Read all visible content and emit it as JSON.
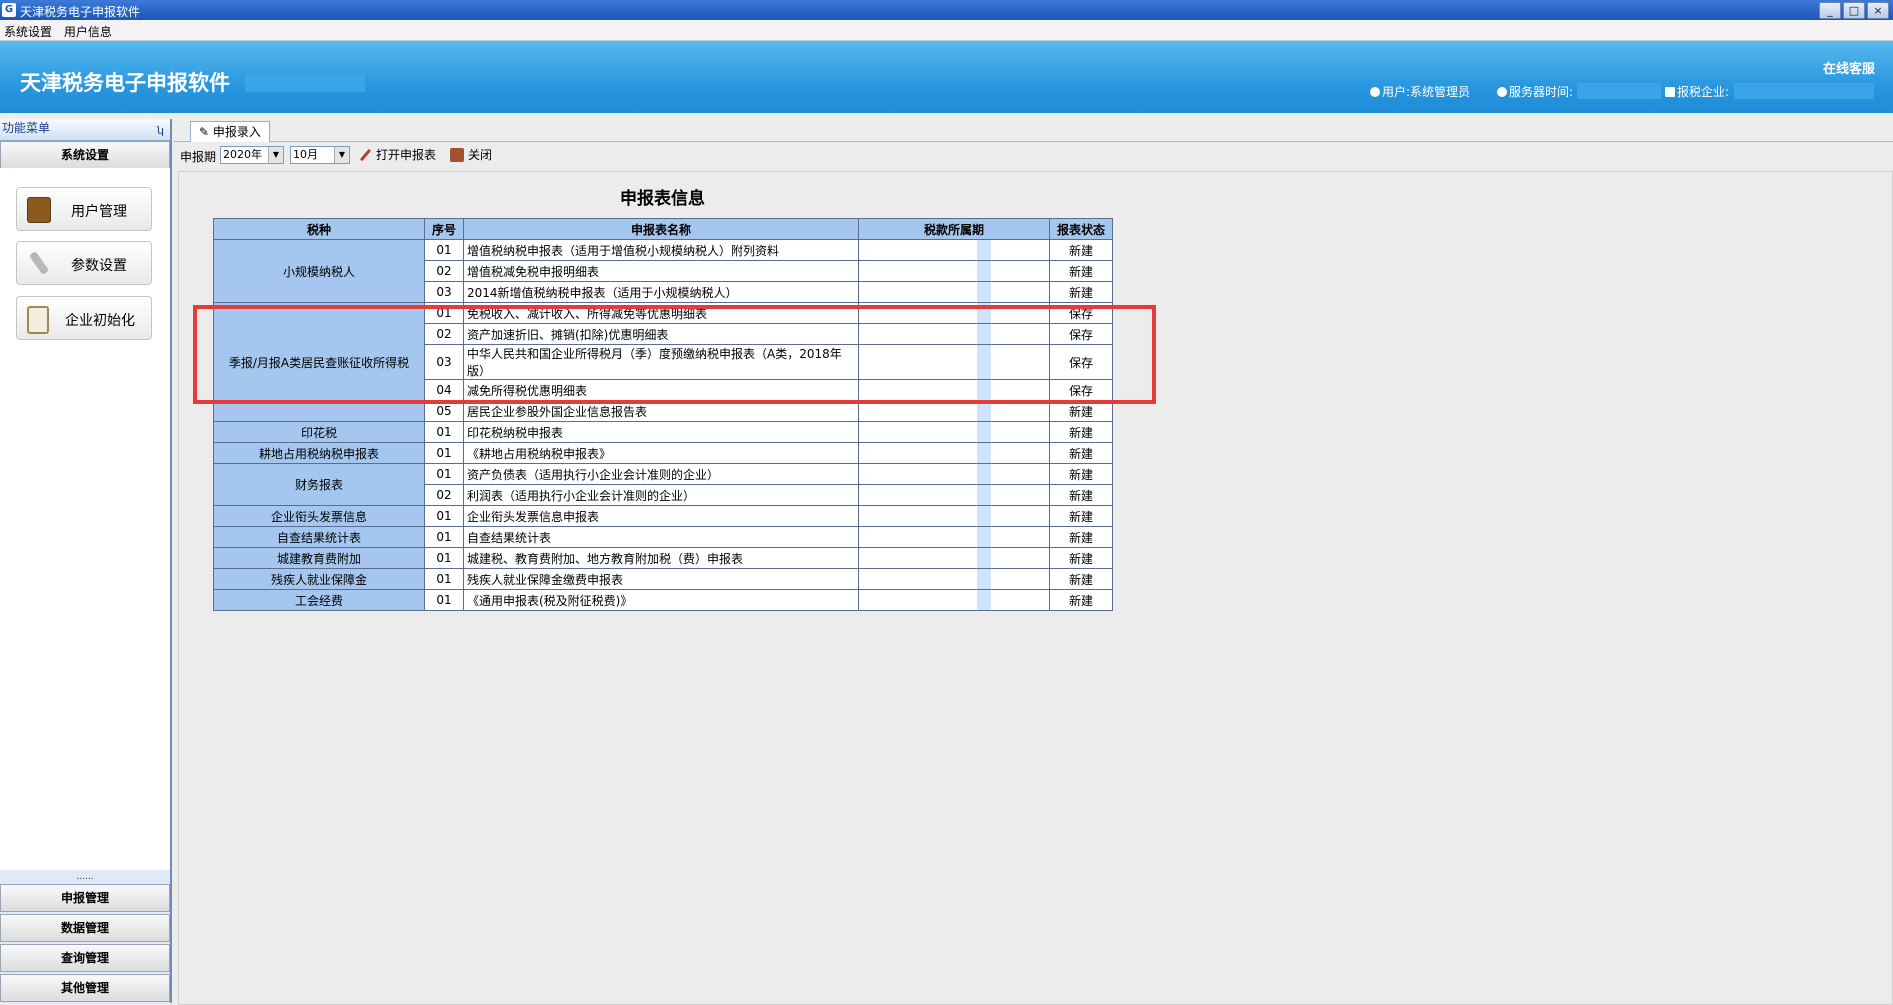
{
  "window": {
    "title": "天津税务电子申报软件",
    "buttons": [
      "_",
      "□",
      "×"
    ]
  },
  "menubar": [
    "系统设置",
    "用户信息"
  ],
  "banner": {
    "app_title": "天津税务电子申报软件",
    "online_service": "在线客服",
    "user_label": "用户:系统管理员",
    "server_time_label": "服务器时间:",
    "company_label": "报税企业:"
  },
  "sidebar": {
    "header": "功能菜单",
    "pin": "ʮ",
    "active_group": "系统设置",
    "tools": [
      {
        "label": "用户管理",
        "icon": "user-book-icon"
      },
      {
        "label": "参数设置",
        "icon": "wrench-icon"
      },
      {
        "label": "企业初始化",
        "icon": "clipboard-icon"
      }
    ],
    "grip": "......",
    "groups": [
      "申报管理",
      "数据管理",
      "查询管理",
      "其他管理"
    ]
  },
  "tabs": [
    {
      "label": "申报录入",
      "icon": "edit-pen-icon"
    }
  ],
  "toolbar": {
    "period_label": "申报期",
    "year": "2020年",
    "month": "10月",
    "open_button": "打开申报表",
    "close_button": "关闭"
  },
  "sheet": {
    "title": "申报表信息",
    "headers": [
      "税种",
      "序号",
      "申报表名称",
      "税款所属期",
      "报表状态"
    ],
    "groups": [
      {
        "tax": "小规模纳税人",
        "rows": [
          {
            "no": "01",
            "name": "增值税纳税申报表（适用于增值税小规模纳税人）附列资料",
            "status": "新建"
          },
          {
            "no": "02",
            "name": "增值税减免税申报明细表",
            "status": "新建"
          },
          {
            "no": "03",
            "name": "2014新增值税纳税申报表（适用于小规模纳税人）",
            "status": "新建"
          }
        ]
      },
      {
        "tax": "季报/月报A类居民查账征收所得税",
        "rows": [
          {
            "no": "01",
            "name": "免税收入、减计收入、所得减免等优惠明细表",
            "status": "保存"
          },
          {
            "no": "02",
            "name": "资产加速折旧、摊销(扣除)优惠明细表",
            "status": "保存"
          },
          {
            "no": "03",
            "name": "中华人民共和国企业所得税月（季）度预缴纳税申报表（A类，2018年版）",
            "status": "保存"
          },
          {
            "no": "04",
            "name": "减免所得税优惠明细表",
            "status": "保存"
          },
          {
            "no": "05",
            "name": "居民企业参股外国企业信息报告表",
            "status": "新建"
          }
        ]
      },
      {
        "tax": "印花税",
        "rows": [
          {
            "no": "01",
            "name": "印花税纳税申报表",
            "status": "新建"
          }
        ]
      },
      {
        "tax": "耕地占用税纳税申报表",
        "rows": [
          {
            "no": "01",
            "name": "《耕地占用税纳税申报表》",
            "status": "新建"
          }
        ]
      },
      {
        "tax": "财务报表",
        "rows": [
          {
            "no": "01",
            "name": "资产负债表（适用执行小企业会计准则的企业）",
            "status": "新建"
          },
          {
            "no": "02",
            "name": "利润表（适用执行小企业会计准则的企业）",
            "status": "新建"
          }
        ]
      },
      {
        "tax": "企业衔头发票信息",
        "rows": [
          {
            "no": "01",
            "name": "企业衔头发票信息申报表",
            "status": "新建"
          }
        ]
      },
      {
        "tax": "自查结果统计表",
        "rows": [
          {
            "no": "01",
            "name": "自查结果统计表",
            "status": "新建"
          }
        ]
      },
      {
        "tax": "城建教育费附加",
        "rows": [
          {
            "no": "01",
            "name": "城建税、教育费附加、地方教育附加税（费）申报表",
            "status": "新建"
          }
        ]
      },
      {
        "tax": "残疾人就业保障金",
        "rows": [
          {
            "no": "01",
            "name": "残疾人就业保障金缴费申报表",
            "status": "新建"
          }
        ]
      },
      {
        "tax": "工会经费",
        "rows": [
          {
            "no": "01",
            "name": "《通用申报表(税及附征税费)》",
            "status": "新建"
          }
        ]
      }
    ]
  },
  "colors": {
    "banner": "#2a98df",
    "header_cell": "#a5c6ef",
    "highlight": "#e53b3b"
  }
}
